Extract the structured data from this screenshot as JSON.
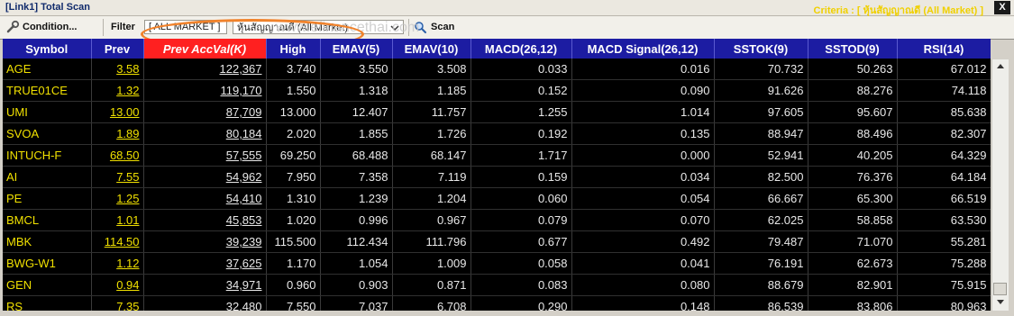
{
  "window": {
    "title": "[Link1] Total Scan",
    "criteria": "Criteria : [ หุ้นสัญญาณดี (All Market) ]",
    "close_label": "X"
  },
  "watermark": "www.efinancethai.com",
  "toolbar": {
    "condition_label": "Condition...",
    "filter_label": "Filter",
    "market_value": "[ ALL MARKET ]",
    "criteria_value": "หุ้นสัญญาณดี (All Market)",
    "scan_label": "Scan"
  },
  "colors": {
    "header_bg": "#1c1ca2",
    "highlight_col": "#ff2020",
    "symbol_text": "#f0e000",
    "annotation": "#f0822b"
  },
  "icons": {
    "condition": "wrench-icon",
    "scan": "magnifier-icon",
    "dropdown": "chevron-down-icon"
  },
  "table": {
    "columns": [
      "Symbol",
      "Prev",
      "Prev AccVal(K)",
      "High",
      "EMAV(5)",
      "EMAV(10)",
      "MACD(26,12)",
      "MACD Signal(26,12)",
      "SSTOK(9)",
      "SSTOD(9)",
      "RSI(14)"
    ],
    "rows": [
      [
        "AGE",
        "3.58",
        "122,367",
        "3.740",
        "3.550",
        "3.508",
        "0.033",
        "0.016",
        "70.732",
        "50.263",
        "67.012"
      ],
      [
        "TRUE01CE",
        "1.32",
        "119,170",
        "1.550",
        "1.318",
        "1.185",
        "0.152",
        "0.090",
        "91.626",
        "88.276",
        "74.118"
      ],
      [
        "UMI",
        "13.00",
        "87,709",
        "13.000",
        "12.407",
        "11.757",
        "1.255",
        "1.014",
        "97.605",
        "95.607",
        "85.638"
      ],
      [
        "SVOA",
        "1.89",
        "80,184",
        "2.020",
        "1.855",
        "1.726",
        "0.192",
        "0.135",
        "88.947",
        "88.496",
        "82.307"
      ],
      [
        "INTUCH-F",
        "68.50",
        "57,555",
        "69.250",
        "68.488",
        "68.147",
        "1.717",
        "0.000",
        "52.941",
        "40.205",
        "64.329"
      ],
      [
        "AI",
        "7.55",
        "54,962",
        "7.950",
        "7.358",
        "7.119",
        "0.159",
        "0.034",
        "82.500",
        "76.376",
        "64.184"
      ],
      [
        "PE",
        "1.25",
        "54,410",
        "1.310",
        "1.239",
        "1.204",
        "0.060",
        "0.054",
        "66.667",
        "65.300",
        "66.519"
      ],
      [
        "BMCL",
        "1.01",
        "45,853",
        "1.020",
        "0.996",
        "0.967",
        "0.079",
        "0.070",
        "62.025",
        "58.858",
        "63.530"
      ],
      [
        "MBK",
        "114.50",
        "39,239",
        "115.500",
        "112.434",
        "111.796",
        "0.677",
        "0.492",
        "79.487",
        "71.070",
        "55.281"
      ],
      [
        "BWG-W1",
        "1.12",
        "37,625",
        "1.170",
        "1.054",
        "1.009",
        "0.058",
        "0.041",
        "76.191",
        "62.673",
        "75.288"
      ],
      [
        "GEN",
        "0.94",
        "34,971",
        "0.960",
        "0.903",
        "0.871",
        "0.083",
        "0.080",
        "88.679",
        "82.901",
        "75.915"
      ],
      [
        "RS",
        "7.35",
        "32,480",
        "7.550",
        "7.037",
        "6.708",
        "0.290",
        "0.148",
        "86.539",
        "83.806",
        "80.963"
      ]
    ]
  }
}
